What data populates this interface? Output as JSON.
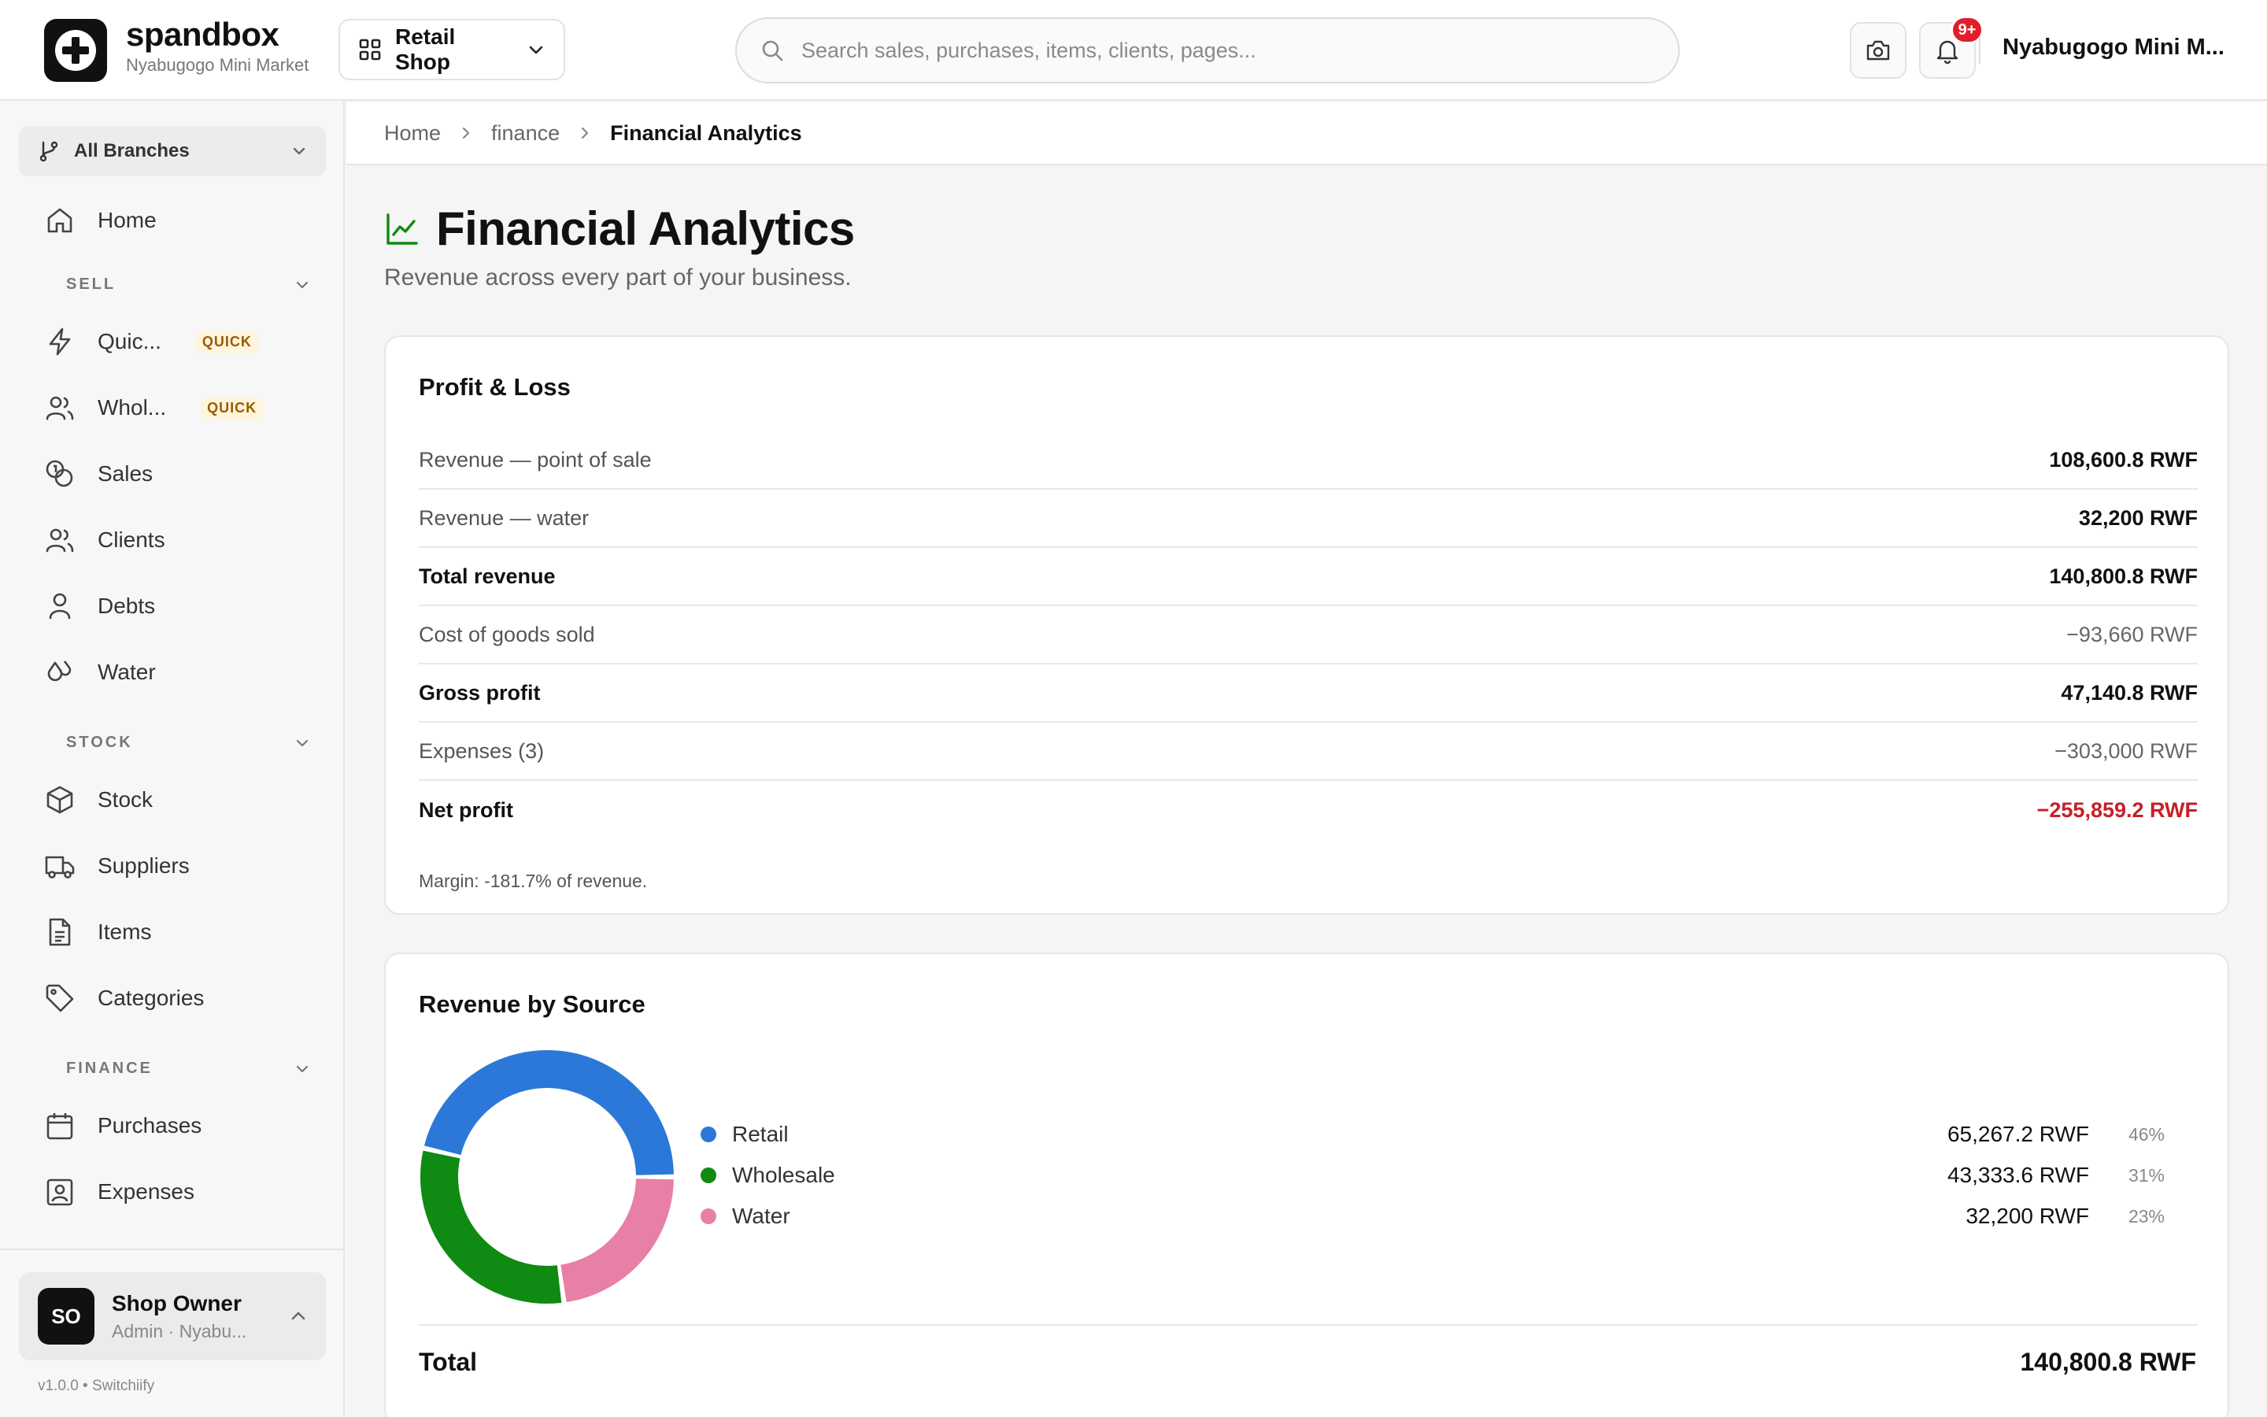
{
  "app": {
    "brand": "spandbox",
    "subtitle": "Nyabugogo Mini Market",
    "shop_selector": "Retail Shop",
    "search_placeholder": "Search sales, purchases, items, clients, pages...",
    "notification_badge": "9+",
    "org_name": "Nyabugogo Mini M..."
  },
  "sidebar": {
    "branch_selector": "All Branches",
    "home": {
      "label": "Home",
      "icon": "home-icon"
    },
    "sections": [
      {
        "title": "SELL",
        "items": [
          {
            "label": "Quic...",
            "icon": "bolt-icon",
            "tag": "QUICK"
          },
          {
            "label": "Whol...",
            "icon": "users-icon",
            "tag": "QUICK"
          },
          {
            "label": "Sales",
            "icon": "coins-icon"
          },
          {
            "label": "Clients",
            "icon": "users-icon"
          },
          {
            "label": "Debts",
            "icon": "user-icon"
          },
          {
            "label": "Water",
            "icon": "droplets-icon"
          }
        ]
      },
      {
        "title": "STOCK",
        "items": [
          {
            "label": "Stock",
            "icon": "box-icon"
          },
          {
            "label": "Suppliers",
            "icon": "truck-icon"
          },
          {
            "label": "Items",
            "icon": "file-icon"
          },
          {
            "label": "Categories",
            "icon": "tag-icon"
          }
        ]
      },
      {
        "title": "FINANCE",
        "items": [
          {
            "label": "Purchases",
            "icon": "calendar-icon"
          },
          {
            "label": "Expenses",
            "icon": "receipt-icon"
          }
        ]
      }
    ],
    "user": {
      "initials": "SO",
      "name": "Shop Owner",
      "role": "Admin · Nyabu..."
    },
    "version": "v1.0.0 • Switchiify"
  },
  "breadcrumb": [
    "Home",
    "finance",
    "Financial Analytics"
  ],
  "page": {
    "title": "Financial Analytics",
    "subtitle": "Revenue across every part of your business."
  },
  "profit_loss": {
    "title": "Profit & Loss",
    "rows": [
      {
        "label": "Revenue — point of sale",
        "value": "108,600.8 RWF"
      },
      {
        "label": "Revenue — water",
        "value": "32,200 RWF"
      },
      {
        "label": "Total revenue",
        "value": "140,800.8 RWF"
      },
      {
        "label": "Cost of goods sold",
        "value": "−93,660 RWF"
      },
      {
        "label": "Gross profit",
        "value": "47,140.8 RWF"
      },
      {
        "label": "Expenses (3)",
        "value": "−303,000 RWF"
      },
      {
        "label": "Net profit",
        "value": "−255,859.2 RWF"
      }
    ],
    "margin_note": "Margin: -181.7% of revenue."
  },
  "revenue_by_source": {
    "title": "Revenue by Source",
    "sources": [
      {
        "name": "Retail",
        "value": "65,267.2 RWF",
        "pct": "46%",
        "amount": 65267.2,
        "color": "#2b78d8"
      },
      {
        "name": "Wholesale",
        "value": "43,333.6 RWF",
        "pct": "31%",
        "amount": 43333.6,
        "color": "#0f8a12"
      },
      {
        "name": "Water",
        "value": "32,200 RWF",
        "pct": "23%",
        "amount": 32200,
        "color": "#e87fa6"
      }
    ],
    "total_label": "Total",
    "total_value": "140,800.8 RWF"
  },
  "colors": {
    "accent_green": "#0f8a12",
    "negative_red": "#c81e28",
    "badge_red": "#e11d2a"
  }
}
